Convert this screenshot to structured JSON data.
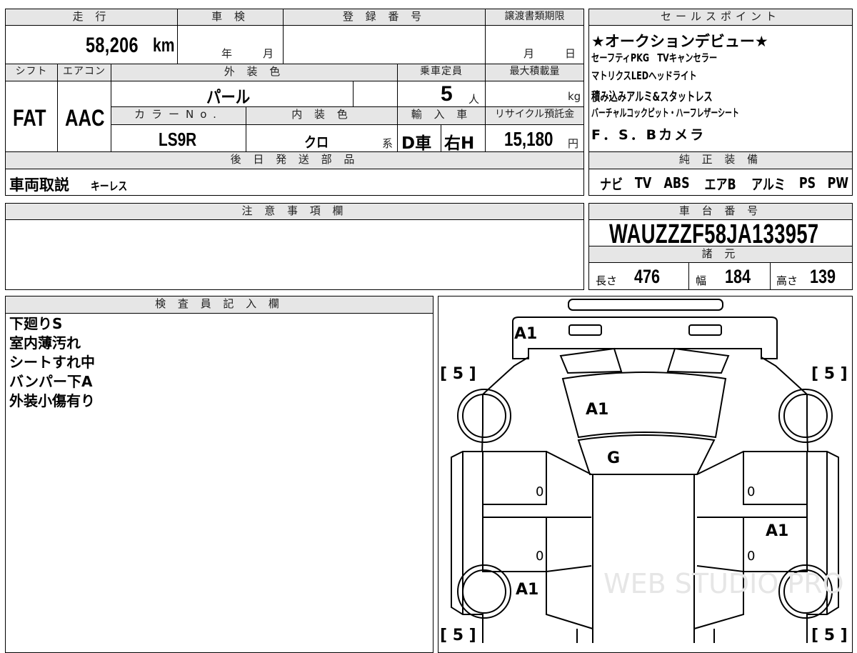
{
  "top_box": {
    "h_mileage": "走 行",
    "h_shaken": "車 検",
    "h_reg_no": "登 録 番 号",
    "h_transfer_deadline": "譲渡書類期限",
    "mileage": "58,206",
    "mileage_unit": "km",
    "shaken_year": "年",
    "shaken_month": "月",
    "deadline_month": "月",
    "deadline_day": "日",
    "h_shift": "シフト",
    "h_aircon": "エアコン",
    "h_exterior_color": "外 装 色",
    "h_capacity": "乗車定員",
    "h_max_load": "最大積載量",
    "shift": "FAT",
    "aircon": "AAC",
    "exterior_color": "パール",
    "capacity": "5",
    "capacity_unit": "人",
    "load_unit": "kg",
    "h_color_no": "カラーNo.",
    "h_interior_color": "内 装 色",
    "h_import": "輸 入 車",
    "h_recycle": "リサイクル預託金",
    "color_no": "LS9R",
    "interior_color": "クロ",
    "interior_suffix": "系",
    "import_type": "D車",
    "steering": "右H",
    "recycle_fee": "15,180",
    "recycle_unit": "円",
    "h_later_parts": "後 日 発 送 部 品",
    "later_parts_main": "車両取説",
    "later_parts_extra": "キーレス"
  },
  "sales_points": {
    "header": "セールスポイント",
    "lines": [
      "★オークションデビュー★",
      "セーフティPKG　TVキャンセラー",
      "マトリクスLEDヘッドライト",
      "積み込みアルミ&スタットレス",
      "バーチャルコックピット・ハーフレザーシート",
      "F．S．Bカメラ"
    ]
  },
  "genuine_equipment": {
    "header": "純 正 装 備",
    "items": [
      "ナビ",
      "TV",
      "ABS",
      "エアB",
      "アルミ",
      "PS",
      "PW"
    ]
  },
  "notes": {
    "header": "注 意 事 項 欄",
    "text": ""
  },
  "chassis": {
    "header": "車 台 番 号",
    "vin": "WAUZZZF58JA133957",
    "spec_header": "諸 元",
    "length_label": "長さ",
    "length": "476",
    "width_label": "幅",
    "width": "184",
    "height_label": "高さ",
    "height": "139"
  },
  "inspector": {
    "header": "検 査 員 記 入 欄",
    "lines": [
      "下廻りS",
      "室内薄汚れ",
      "シートすれ中",
      "バンパー下A",
      "外装小傷有り"
    ]
  },
  "diagram": {
    "tire_fl": "[ 5 ]",
    "tire_fr": "[ 5 ]",
    "tire_rl": "[ 5 ]",
    "tire_rr": "[ 5 ]",
    "mark_front_bumper": "A1",
    "mark_hood": "A1",
    "mark_windshield": "G",
    "mark_left_front_door": "0",
    "mark_left_rear_door": "0",
    "mark_right_front_door": "0",
    "mark_right_rear_door": "0",
    "mark_right_rear_door_damage": "A1",
    "mark_left_rear_fender": "A1",
    "watermark": "WEB STUDIO PRO"
  }
}
